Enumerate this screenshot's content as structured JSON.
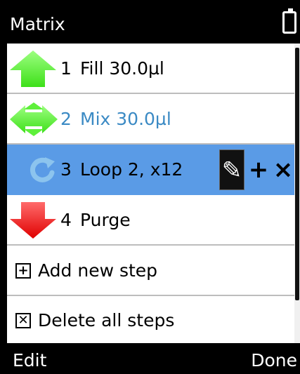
{
  "window": {
    "title": "Matrix"
  },
  "steps": [
    {
      "number": "1",
      "label": "Fill 30.0µl",
      "icon": "arrow-up-icon",
      "color": "#66ff44"
    },
    {
      "number": "2",
      "label": "Mix 30.0µl",
      "icon": "mix-arrows-icon",
      "color": "#66ff44"
    },
    {
      "number": "3",
      "label": "Loop 2, x12",
      "icon": "loop-icon",
      "color": "#7fb8e8"
    },
    {
      "number": "4",
      "label": "Purge",
      "icon": "arrow-down-icon",
      "color": "#ff2a2a"
    }
  ],
  "row_actions": {
    "edit": "✎",
    "add": "+",
    "delete": "×"
  },
  "menu": {
    "add_step": {
      "icon": "+",
      "label": "Add new step"
    },
    "delete_all": {
      "icon": "✕",
      "label": "Delete all steps"
    }
  },
  "softkeys": {
    "left": "Edit",
    "right": "Done"
  },
  "colors": {
    "selected": "#5a9be6",
    "mix_text": "#3b8ac4"
  }
}
